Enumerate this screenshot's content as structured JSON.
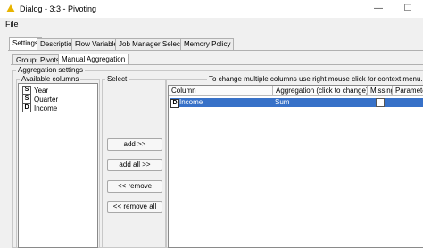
{
  "window": {
    "title": "Dialog - 3:3 - Pivoting",
    "minimize": "—",
    "maximize": "☐"
  },
  "menu": {
    "file": "File"
  },
  "tabs": [
    "Settings",
    "Description",
    "Flow Variables",
    "Job Manager Selection",
    "Memory Policy"
  ],
  "subtabs": [
    "Groups",
    "Pivots",
    "Manual Aggregation"
  ],
  "aggregation": {
    "group_title": "Aggregation settings",
    "available_title": "Available columns",
    "select_title": "Select",
    "hint": "To change multiple columns use right mouse click for context menu.",
    "columns": [
      {
        "type": "S",
        "name": "Year"
      },
      {
        "type": "S",
        "name": "Quarter"
      },
      {
        "type": "D",
        "name": "Income"
      }
    ],
    "buttons": {
      "add": "add >>",
      "add_all": "add all >>",
      "remove": "<< remove",
      "remove_all": "<< remove all"
    },
    "table": {
      "headers": [
        "Column",
        "Aggregation (click to change)",
        "Missing",
        "Parameter"
      ],
      "rows": [
        {
          "type": "D",
          "column": "Income",
          "aggregation": "Sum",
          "missing": false
        }
      ]
    }
  }
}
